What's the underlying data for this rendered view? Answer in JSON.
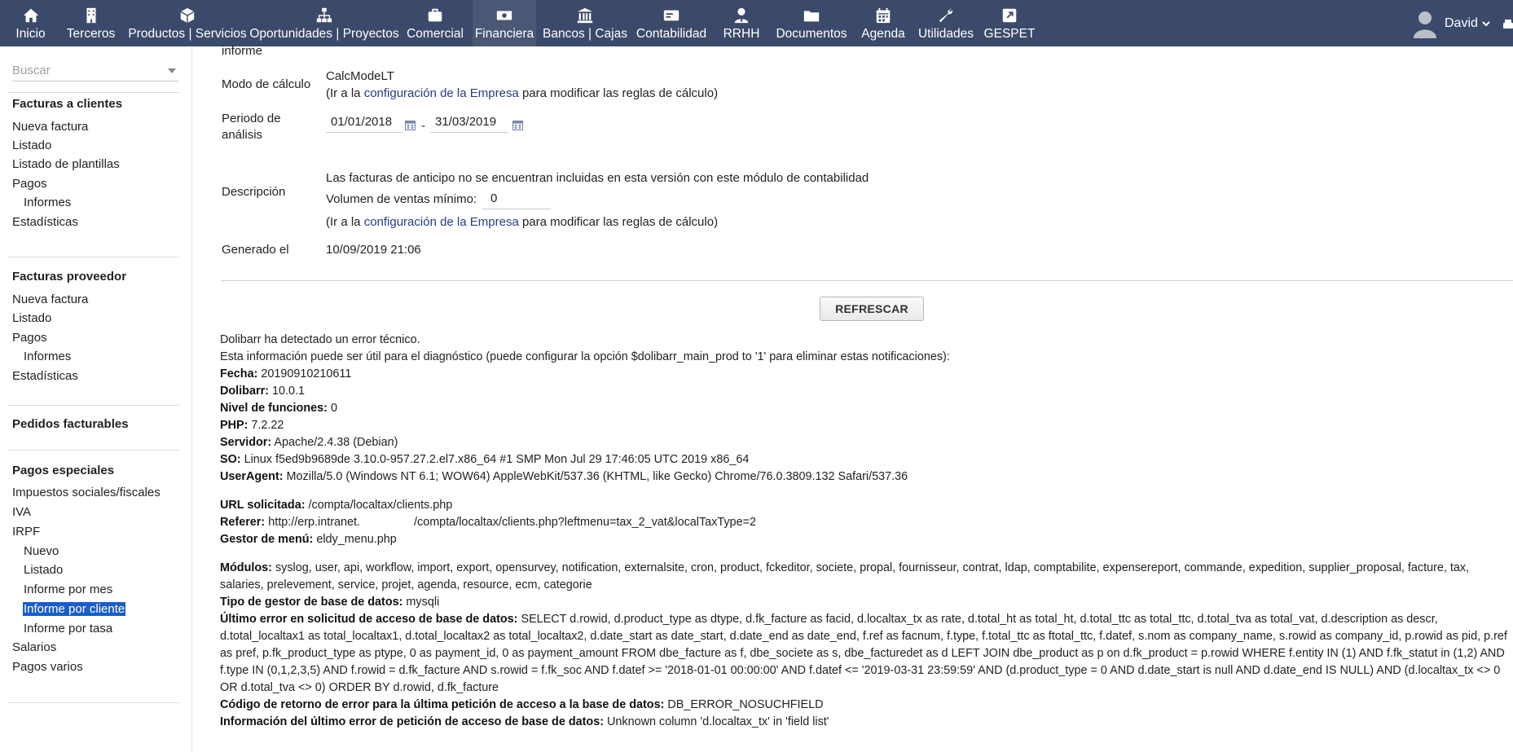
{
  "topbar": {
    "items": [
      {
        "label": "Inicio",
        "icon": "home-icon"
      },
      {
        "label": "Terceros",
        "icon": "building-icon"
      },
      {
        "label": "Productos | Servicios",
        "icon": "cube-icon"
      },
      {
        "label": "Oportunidades | Proyectos",
        "icon": "sitemap-icon"
      },
      {
        "label": "Comercial",
        "icon": "briefcase-icon"
      },
      {
        "label": "Financiera",
        "icon": "money-icon"
      },
      {
        "label": "Bancos | Cajas",
        "icon": "bank-icon"
      },
      {
        "label": "Contabilidad",
        "icon": "card-icon"
      },
      {
        "label": "RRHH",
        "icon": "user-tie-icon"
      },
      {
        "label": "Documentos",
        "icon": "folder-icon"
      },
      {
        "label": "Agenda",
        "icon": "calendar-icon"
      },
      {
        "label": "Utilidades",
        "icon": "wrench-icon"
      },
      {
        "label": "GESPET",
        "icon": "external-link-icon"
      }
    ],
    "user_name": "David"
  },
  "sidebar": {
    "search_placeholder": "Buscar",
    "sections": {
      "clientes_title": "Facturas a clientes",
      "clientes_nueva": "Nueva factura",
      "clientes_listado": "Listado",
      "clientes_plantillas": "Listado de plantillas",
      "clientes_pagos": "Pagos",
      "clientes_informes": "Informes",
      "clientes_estadisticas": "Estadísticas",
      "proveedor_title": "Facturas proveedor",
      "proveedor_nueva": "Nueva factura",
      "proveedor_listado": "Listado",
      "proveedor_pagos": "Pagos",
      "proveedor_informes": "Informes",
      "proveedor_estadisticas": "Estadísticas",
      "pedidos_title": "Pedidos facturables",
      "pagos_title": "Pagos especiales",
      "impuestos": "Impuestos sociales/fiscales",
      "iva": "IVA",
      "irpf": "IRPF",
      "irpf_nuevo": "Nuevo",
      "irpf_listado": "Listado",
      "irpf_mes": "Informe por mes",
      "irpf_cliente": "Informe por cliente",
      "irpf_tasa": "Informe por tasa",
      "salarios": "Salarios",
      "pagos_varios": "Pagos varios"
    }
  },
  "report": {
    "informe_label": "informe",
    "modo_label": "Modo de cálculo",
    "modo_value": "CalcModeLT",
    "ir_prefix": "(Ir a la ",
    "ir_link": "configuración de la Empresa",
    "ir_suffix": " para modificar las reglas de cálculo)",
    "periodo_label_1": "Periodo de",
    "periodo_label_2": "análisis",
    "date_from": "01/01/2018",
    "date_sep": "-",
    "date_to": "31/03/2019",
    "descripcion_label": "Descripción",
    "descripcion_text": "Las facturas de anticipo no se encuentran incluidas en esta versión con este módulo de contabilidad",
    "volumen_label": "Volumen de ventas mínimo:",
    "volumen_value": "0",
    "generado_label": "Generado el",
    "generado_value": "10/09/2019 21:06",
    "refresh_button": "REFRESCAR"
  },
  "error": {
    "line1": "Dolibarr ha detectado un error técnico.",
    "line2": "Esta información puede ser útil para el diagnóstico (puede configurar la opción $dolibarr_main_prod to '1' para eliminar estas notificaciones):",
    "fecha_k": "Fecha:",
    "fecha_v": " 20190910210611",
    "dolibarr_k": "Dolibarr:",
    "dolibarr_v": " 10.0.1",
    "nivel_k": "Nivel de funciones:",
    "nivel_v": " 0",
    "php_k": "PHP:",
    "php_v": " 7.2.22",
    "servidor_k": "Servidor:",
    "servidor_v": " Apache/2.4.38 (Debian)",
    "so_k": "SO:",
    "so_v": " Linux f5ed9b9689de 3.10.0-957.27.2.el7.x86_64 #1 SMP Mon Jul 29 17:46:05 UTC 2019 x86_64",
    "ua_k": "UserAgent:",
    "ua_v": " Mozilla/5.0 (Windows NT 6.1; WOW64) AppleWebKit/537.36 (KHTML, like Gecko) Chrome/76.0.3809.132 Safari/537.36",
    "url_k": "URL solicitada:",
    "url_v": " /compta/localtax/clients.php",
    "referer_k": "Referer:",
    "referer_v1": " http://erp.intranet.",
    "referer_v2": "/compta/localtax/clients.php?leftmenu=tax_2_vat&localTaxType=2",
    "gestor_k": "Gestor de menú:",
    "gestor_v": " eldy_menu.php",
    "modulos_k": "Módulos:",
    "modulos_v": " syslog, user, api, workflow, import, export, opensurvey, notification, externalsite, cron, product, fckeditor, societe, propal, fournisseur, contrat, ldap, comptabilite, expensereport, commande, expedition, supplier_proposal, facture, tax, salaries, prelevement, service, projet, agenda, resource, ecm, categorie",
    "tipo_k": "Tipo de gestor de base de datos:",
    "tipo_v": " mysqli",
    "ultimo_k": "Último error en solicitud de acceso de base de datos:",
    "ultimo_v": " SELECT d.rowid, d.product_type as dtype, d.fk_facture as facid, d.localtax_tx as rate, d.total_ht as total_ht, d.total_ttc as total_ttc, d.total_tva as total_vat, d.description as descr, d.total_localtax1 as total_localtax1, d.total_localtax2 as total_localtax2, d.date_start as date_start, d.date_end as date_end, f.ref as facnum, f.type, f.total_ttc as ftotal_ttc, f.datef, s.nom as company_name, s.rowid as company_id, p.rowid as pid, p.ref as pref, p.fk_product_type as ptype, 0 as payment_id, 0 as payment_amount FROM dbe_facture as f, dbe_societe as s, dbe_facturedet as d LEFT JOIN dbe_product as p on d.fk_product = p.rowid WHERE f.entity IN (1) AND f.fk_statut in (1,2) AND f.type IN (0,1,2,3,5) AND f.rowid = d.fk_facture AND s.rowid = f.fk_soc AND f.datef >= '2018-01-01 00:00:00' AND f.datef <= '2019-03-31 23:59:59' AND (d.product_type = 0 AND d.date_start is null AND d.date_end IS NULL) AND (d.localtax_tx <> 0 OR d.total_tva <> 0) ORDER BY d.rowid, d.fk_facture",
    "codigo_k": "Código de retorno de error para la última petición de acceso a la base de datos:",
    "codigo_v": " DB_ERROR_NOSUCHFIELD",
    "info_k": "Información del último error de petición de acceso de base de datos:",
    "info_v": " Unknown column 'd.localtax_tx' in 'field list'"
  }
}
